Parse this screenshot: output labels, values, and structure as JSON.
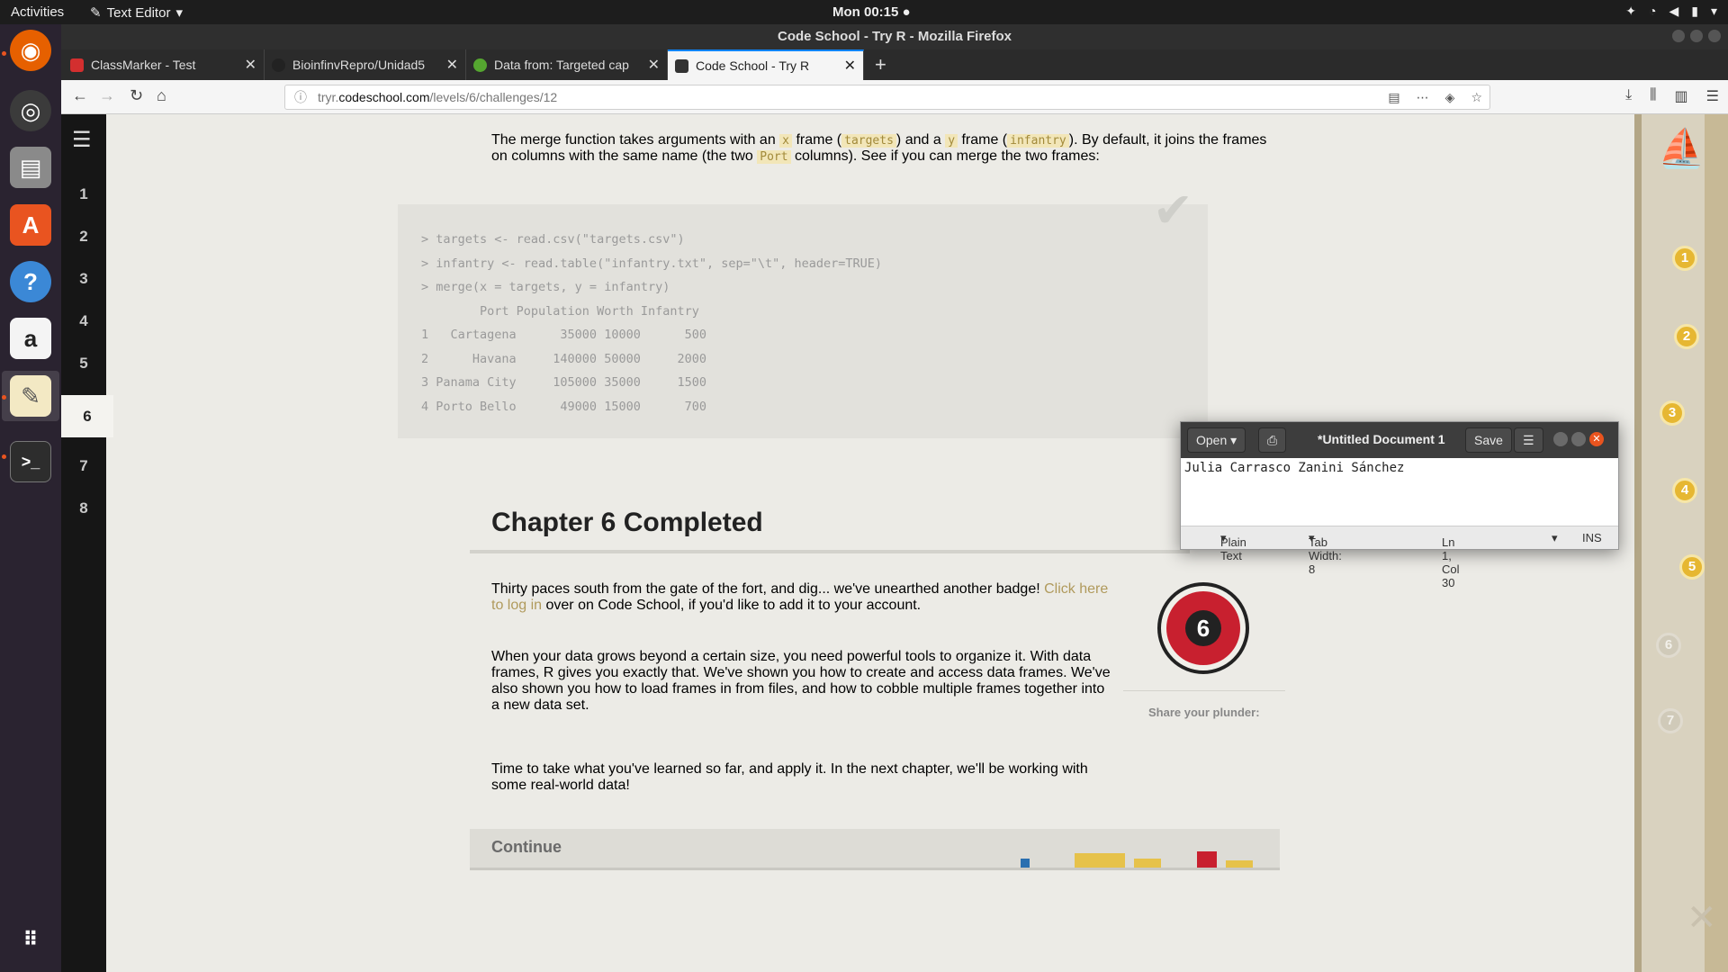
{
  "topbar": {
    "activities": "Activities",
    "app_menu": "Text Editor",
    "clock": "Mon 00:15"
  },
  "window": {
    "title": "Code School - Try R - Mozilla Firefox"
  },
  "tabs": [
    {
      "title": "ClassMarker - Test",
      "favicon_color": "#d32f2f"
    },
    {
      "title": "BioinfinvRepro/Unidad5",
      "favicon_color": "#222222"
    },
    {
      "title": "Data from: Targeted cap",
      "favicon_color": "#55a630"
    },
    {
      "title": "Code School - Try R",
      "favicon_color": "#333333",
      "active": true
    }
  ],
  "url": {
    "prefix": "tryr.",
    "host": "codeschool.com",
    "path": "/levels/6/challenges/12"
  },
  "chapters": [
    "1",
    "2",
    "3",
    "4",
    "5",
    "6",
    "7",
    "8"
  ],
  "current_chapter": "6",
  "intro": {
    "t1": "The merge function takes arguments with an ",
    "c1": "x",
    "t2": " frame (",
    "c2": "targets",
    "t3": ") and a ",
    "c3": "y",
    "t4": " frame (",
    "c4": "infantry",
    "t5": "). By default, it joins the frames on columns with the same name (the two ",
    "c5": "Port",
    "t6": " columns). See if you can merge the two frames:"
  },
  "code_lines": [
    "> targets <- read.csv(\"targets.csv\")",
    "> infantry <- read.table(\"infantry.txt\", sep=\"\\t\", header=TRUE)",
    "> merge(x = targets, y = infantry)",
    "        Port Population Worth Infantry",
    "1   Cartagena      35000 10000      500",
    "2      Havana     140000 50000     2000",
    "3 Panama City     105000 35000     1500",
    "4 Porto Bello      49000 15000      700"
  ],
  "chapter_title": "Chapter 6 Completed",
  "p1": {
    "text": "Thirty paces south from the gate of the fort, and dig... we've unearthed another badge! ",
    "link": "Click here to log in",
    "rest": " over on Code School, if you'd like to add it to your account."
  },
  "p2": "When your data grows beyond a certain size, you need powerful tools to organize it. With data frames, R gives you exactly that. We've shown you how to create and access data frames. We've also shown you how to load frames in from files, and how to cobble multiple frames together into a new data set.",
  "p3": "Time to take what you've learned so far, and apply it. In the next chapter, we'll be working with some real-world data!",
  "badge_number": "6",
  "share_label": "Share your plunder:",
  "continue_label": "Continue",
  "map_stops": [
    {
      "n": "1",
      "state": "done"
    },
    {
      "n": "2",
      "state": "done"
    },
    {
      "n": "3",
      "state": "done"
    },
    {
      "n": "4",
      "state": "done"
    },
    {
      "n": "5",
      "state": "done"
    },
    {
      "n": "6",
      "state": "locked"
    },
    {
      "n": "7",
      "state": "locked"
    }
  ],
  "gedit": {
    "open": "Open",
    "title": "*Untitled Document 1",
    "save": "Save",
    "content": "Julia Carrasco Zanini Sánchez",
    "language": "Plain Text",
    "tab_width": "Tab Width: 8",
    "position": "Ln 1, Col 30",
    "mode": "INS"
  }
}
